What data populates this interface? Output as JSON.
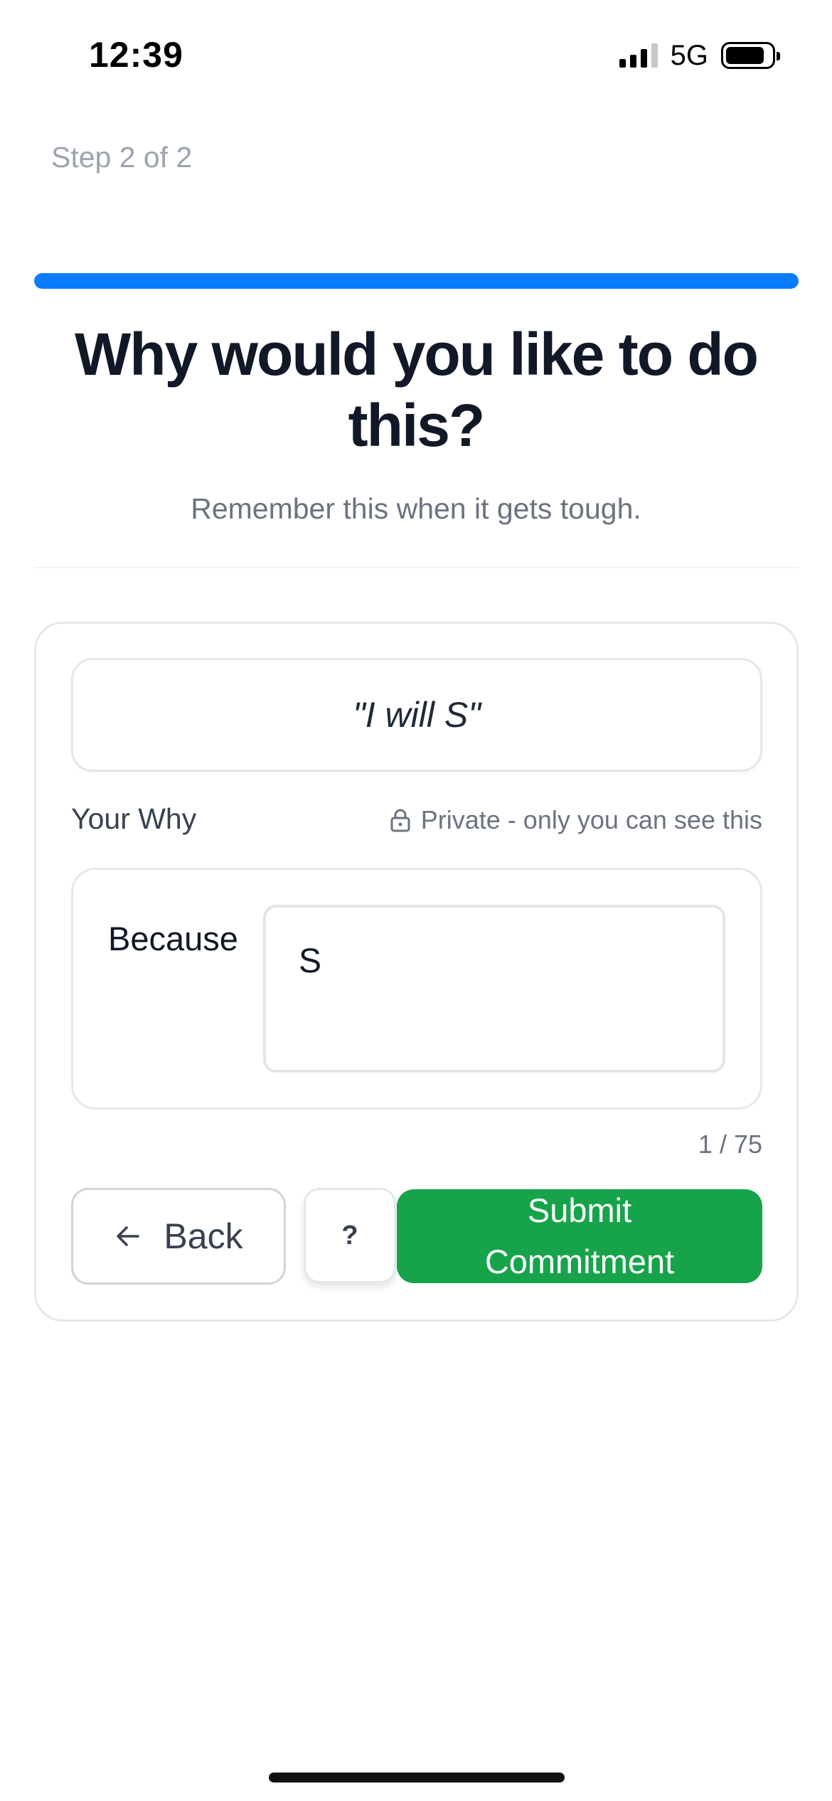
{
  "status_bar": {
    "time": "12:39",
    "network": "5G",
    "signal_bars": 3,
    "battery_level": 0.8
  },
  "step": {
    "label": "Step 2 of 2",
    "progress": 1.0,
    "progress_color": "#0a7cff"
  },
  "header": {
    "title": "Why would you like to do this?",
    "subtitle": "Remember this when it gets tough."
  },
  "card": {
    "commitment_quote": "\"I will S\"",
    "why_label": "Your Why",
    "privacy_note": "Private - only you can see this",
    "because_label": "Because",
    "why_input_value": "S",
    "char_counter": "1 / 75"
  },
  "actions": {
    "back_label": "Back",
    "help_label": "?",
    "submit_label": "Submit Commitment",
    "submit_color": "#16a34a"
  },
  "icons": {
    "lock": "lock-icon",
    "back": "arrow-left-icon",
    "battery": "battery-icon",
    "signal": "signal-icon"
  }
}
